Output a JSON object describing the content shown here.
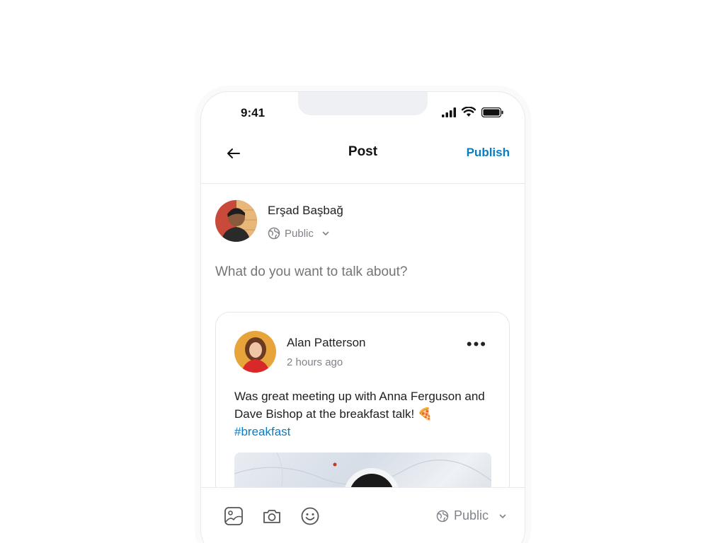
{
  "status_bar": {
    "time": "9:41"
  },
  "header": {
    "title": "Post",
    "publish_label": "Publish"
  },
  "author": {
    "name": "Erşad Başbağ",
    "visibility": "Public"
  },
  "compose": {
    "placeholder": "What do you want to talk about?"
  },
  "shared_post": {
    "author_name": "Alan Patterson",
    "timestamp": "2 hours ago",
    "text": "Was great meeting up with Anna Ferguson and Dave Bishop at the breakfast talk! 🍕",
    "hashtag": "#breakfast"
  },
  "toolbar": {
    "visibility": "Public"
  },
  "icons": {
    "back": "arrow-left-icon",
    "globe": "globe-icon",
    "chevron": "chevron-down-icon",
    "more": "more-horizontal-icon",
    "image": "image-icon",
    "camera": "camera-icon",
    "emoji": "smile-icon",
    "signal": "signal-icon",
    "wifi": "wifi-icon",
    "battery": "battery-icon"
  },
  "colors": {
    "accent": "#0a7cc1",
    "muted": "#808389",
    "placeholder": "#9a9ea5"
  }
}
